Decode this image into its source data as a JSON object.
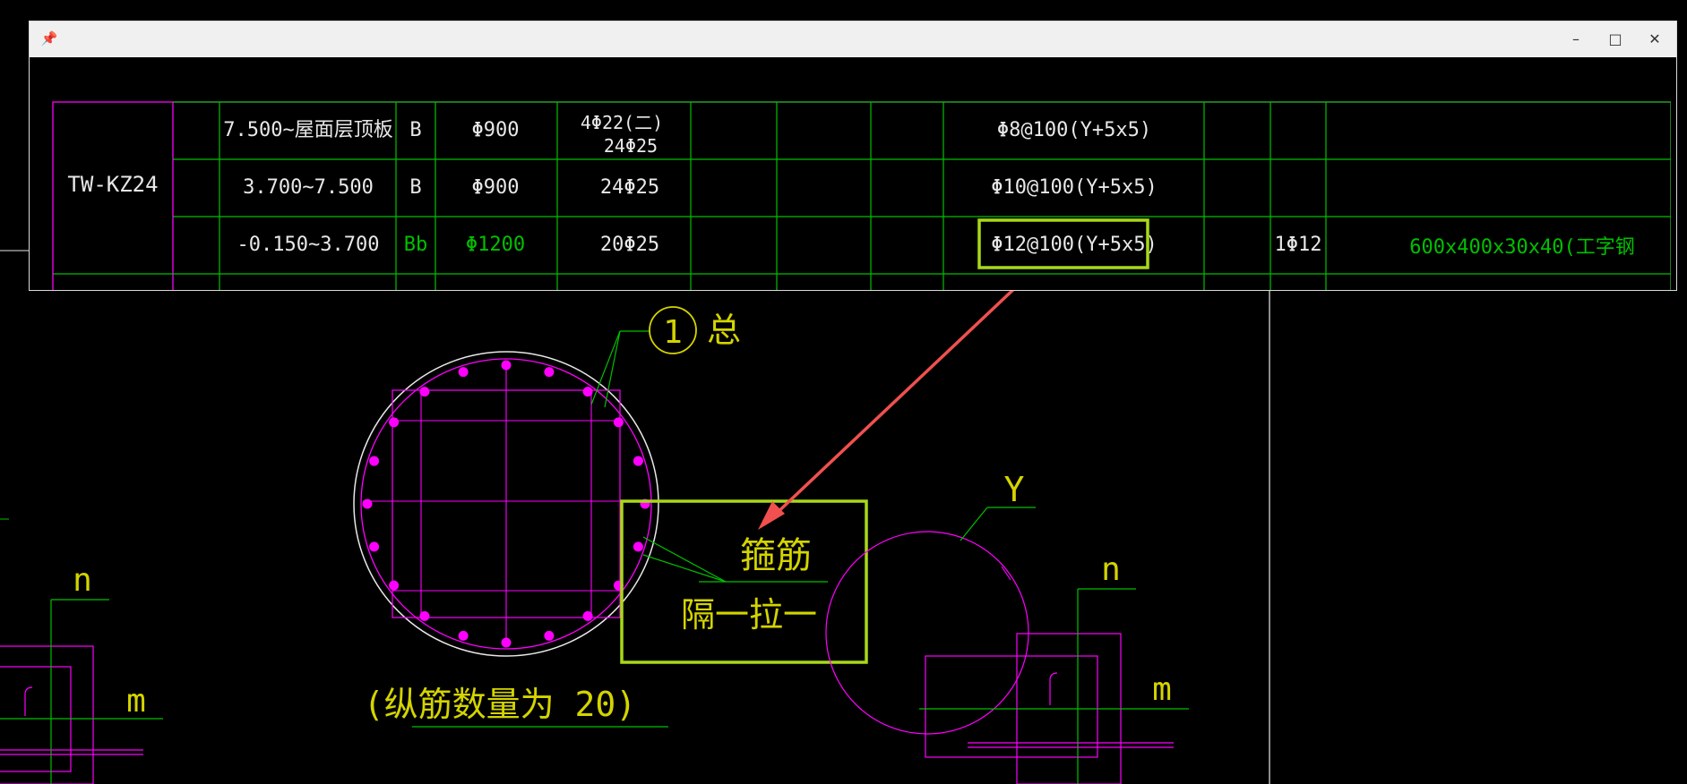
{
  "window": {
    "pin_icon": "pin-icon",
    "minimize_icon": "minimize-icon",
    "maximize_icon": "maximize-icon",
    "close_icon": "close-icon"
  },
  "table": {
    "column_id": "TW-KZ24",
    "rows": [
      {
        "elevation": "7.500~屋面层顶板",
        "type": "B",
        "diameter": "Φ900",
        "bars_line1": "4Φ22(二)",
        "bars_line2": "24Φ25",
        "stirrup": "Φ8@100(Y+5x5)",
        "extra": "",
        "steel": "",
        "color_emphasis": false
      },
      {
        "elevation": "3.700~7.500",
        "type": "B",
        "diameter": "Φ900",
        "bars_line1": "24Φ25",
        "bars_line2": "",
        "stirrup": "Φ10@100(Y+5x5)",
        "extra": "",
        "steel": "",
        "color_emphasis": false
      },
      {
        "elevation": "-0.150~3.700",
        "type": "Bb",
        "diameter": "Φ1200",
        "bars_line1": "20Φ25",
        "bars_line2": "",
        "stirrup": "Φ12@100(Y+5x5)",
        "extra": "1Φ12",
        "steel": "600x400x30x40(工字钢",
        "color_emphasis": true
      }
    ]
  },
  "drawing": {
    "callout_number": "1",
    "callout_suffix": "总",
    "stirrup_label": "箍筋",
    "tie_label": "隔一拉一",
    "bar_count_note": "(纵筋数量为 20)",
    "label_y": "Y",
    "label_n_left": "n",
    "label_m_left": "m",
    "label_n_right": "n",
    "label_m_right": "m"
  },
  "colors": {
    "magenta": "#ff00ff",
    "green": "#00c000",
    "yellow": "#d4d400",
    "highlight": "#a8d818",
    "arrow": "#f0504f",
    "white": "#e8e8e8"
  }
}
